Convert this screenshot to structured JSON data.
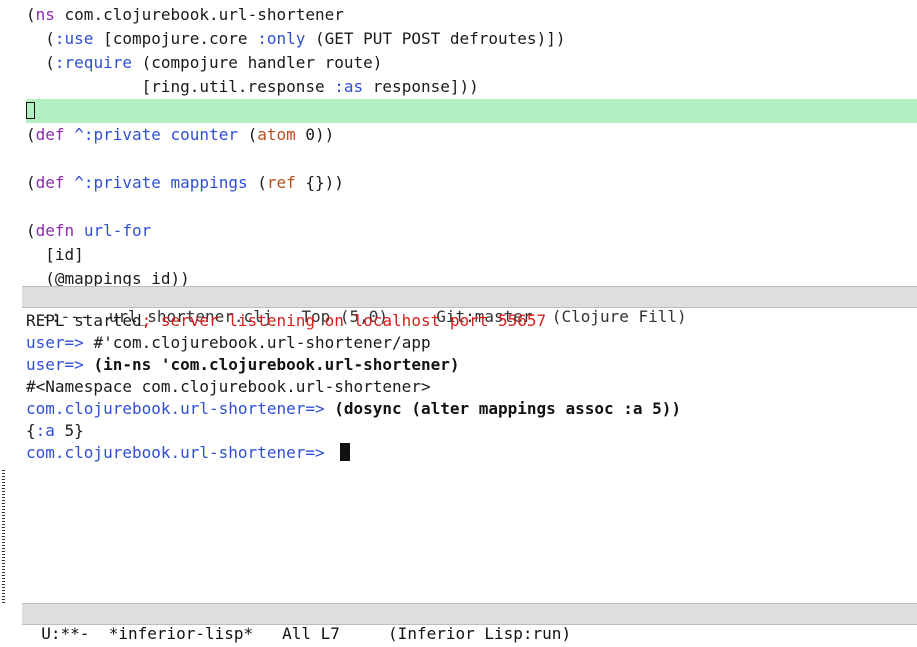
{
  "editor": {
    "lines": [
      {
        "parts": [
          [
            "(",
            "plain"
          ],
          [
            "ns",
            "kw"
          ],
          [
            " com.clojurebook.url-shortener",
            "plain"
          ]
        ]
      },
      {
        "parts": [
          [
            "  (",
            "plain"
          ],
          [
            ":use",
            "sym"
          ],
          [
            " [compojure.core ",
            "plain"
          ],
          [
            ":only",
            "sym"
          ],
          [
            " (GET PUT POST defroutes)])",
            "plain"
          ]
        ]
      },
      {
        "parts": [
          [
            "  (",
            "plain"
          ],
          [
            ":require",
            "sym"
          ],
          [
            " (compojure handler route)",
            "plain"
          ]
        ]
      },
      {
        "parts": [
          [
            "            [ring.util.response ",
            "plain"
          ],
          [
            ":as",
            "sym"
          ],
          [
            " response]))",
            "plain"
          ]
        ]
      },
      {
        "parts": []
      },
      {
        "parts": [
          [
            "(",
            "plain"
          ],
          [
            "def",
            "kw"
          ],
          [
            " ",
            "plain"
          ],
          [
            "^:private",
            "sym"
          ],
          [
            " ",
            "plain"
          ],
          [
            "counter",
            "blue"
          ],
          [
            " (",
            "plain"
          ],
          [
            "atom",
            "fn"
          ],
          [
            " 0))",
            "plain"
          ]
        ]
      },
      {
        "parts": []
      },
      {
        "parts": [
          [
            "(",
            "plain"
          ],
          [
            "def",
            "kw"
          ],
          [
            " ",
            "plain"
          ],
          [
            "^:private",
            "sym"
          ],
          [
            " ",
            "plain"
          ],
          [
            "mappings",
            "blue"
          ],
          [
            " (",
            "plain"
          ],
          [
            "ref",
            "fn"
          ],
          [
            " {}))",
            "plain"
          ]
        ]
      },
      {
        "parts": []
      },
      {
        "parts": [
          [
            "(",
            "plain"
          ],
          [
            "defn",
            "kw"
          ],
          [
            " ",
            "plain"
          ],
          [
            "url-for",
            "blue"
          ]
        ]
      },
      {
        "parts": [
          [
            "  [id]",
            "plain"
          ]
        ]
      },
      {
        "parts": [
          [
            "  (@mappings id))",
            "plain"
          ]
        ]
      }
    ]
  },
  "modeline_top": "-:---  url_shortener.clj   Top (5,0)     Git:master  (Clojure Fill)",
  "repl": {
    "lines": [
      {
        "parts": [
          [
            "REPL started",
            "plain"
          ],
          [
            "; server listening on localhost port 55657",
            "red"
          ]
        ]
      },
      {
        "parts": [
          [
            "user=> ",
            "prompt"
          ],
          [
            "#'com.clojurebook.url-shortener/app",
            "plain"
          ]
        ]
      },
      {
        "parts": [
          [
            "user=> ",
            "prompt"
          ],
          [
            "(in-ns 'com.clojurebook.url-shortener)",
            "bold"
          ]
        ]
      },
      {
        "parts": [
          [
            "#<Namespace com.clojurebook.url-shortener>",
            "plain"
          ]
        ]
      },
      {
        "parts": [
          [
            "com.clojurebook.url-shortener=> ",
            "prompt"
          ],
          [
            "(dosync (alter mappings assoc :a 5))",
            "bold"
          ]
        ]
      },
      {
        "parts": [
          [
            "{",
            "plain"
          ],
          [
            ":a",
            "sym"
          ],
          [
            " 5}",
            "plain"
          ]
        ]
      },
      {
        "parts": [
          [
            "com.clojurebook.url-shortener=> ",
            "prompt"
          ]
        ]
      }
    ]
  },
  "modeline_bottom": "U:**-  *inferior-lisp*   All L7     (Inferior Lisp:run)"
}
